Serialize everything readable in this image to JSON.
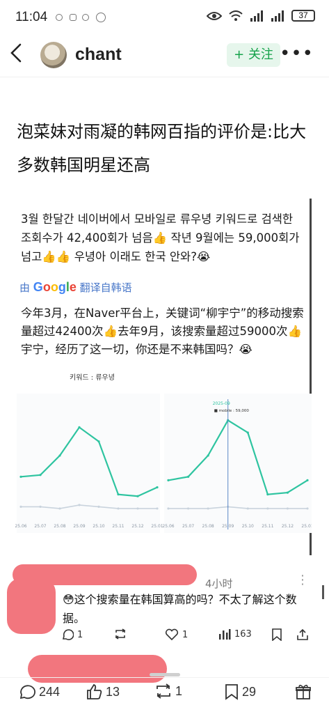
{
  "status": {
    "time": "11:04",
    "battery": "37"
  },
  "nav": {
    "author": "chant",
    "follow_label": "+ 关注",
    "more_label": "•••"
  },
  "post": {
    "title": "泡菜妹对雨凝的韩网百指的评价是:比大多数韩国明星还高"
  },
  "screenshot": {
    "korean_text": "3월 한달간 네이버에서 모바일로 류우녕 키워드로 검색한 조회수가 42,400회가 넘음👍 작년 9월에는 59,000회가 넘고👍👍 우녕아 이래도 한국 안와?😭",
    "translate_prefix": "由",
    "translate_google": "Google",
    "translate_suffix": "翻译自韩语",
    "chinese_text": "今年3月，在Naver平台上，关键词“柳宇宁”的移动搜索量超过42400次👍去年9月，该搜索量超过59000次👍宇宁，经历了这一切，你还是不来韩国吗？😭",
    "chart_keyword": "키워드 : 류우녕"
  },
  "chart_data": [
    {
      "type": "line",
      "x": [
        "25.06",
        "25.07",
        "25.08",
        "25.09",
        "25.10",
        "25.11",
        "25.12",
        "25.01"
      ],
      "series": [
        {
          "values": [
            20,
            21,
            32,
            48,
            40,
            10,
            9,
            14
          ],
          "color": "#2ec4a0"
        },
        {
          "values": [
            3,
            3,
            2,
            4,
            3,
            2,
            2,
            2
          ],
          "color": "#c9d3dd"
        }
      ]
    },
    {
      "type": "line",
      "x": [
        "25.06",
        "25.07",
        "25.08",
        "25.09",
        "25.10",
        "25.11",
        "25.12",
        "25.01"
      ],
      "tooltip": {
        "date": "2025-09",
        "label": "mobile",
        "value": "59,000"
      },
      "series": [
        {
          "values": [
            18,
            20,
            32,
            52,
            45,
            10,
            11,
            18
          ],
          "color": "#2ec4a0"
        },
        {
          "values": [
            2,
            2,
            2,
            3,
            2,
            2,
            2,
            2
          ],
          "color": "#c9d3dd"
        }
      ]
    }
  ],
  "comment": {
    "time": "4小时",
    "text": "😳这个搜索量在韩国算高的吗？不太了解这个数据。",
    "reply_count": "1",
    "like_count": "1",
    "view_count": "163"
  },
  "bottom": {
    "comments": "244",
    "likes": "13",
    "reposts": "1",
    "favorites": "29"
  },
  "colors": {
    "accent_green": "#15a24a",
    "follow_bg": "#e6f6ec",
    "chart_line": "#2ec4a0",
    "redaction": "#f2767e"
  }
}
